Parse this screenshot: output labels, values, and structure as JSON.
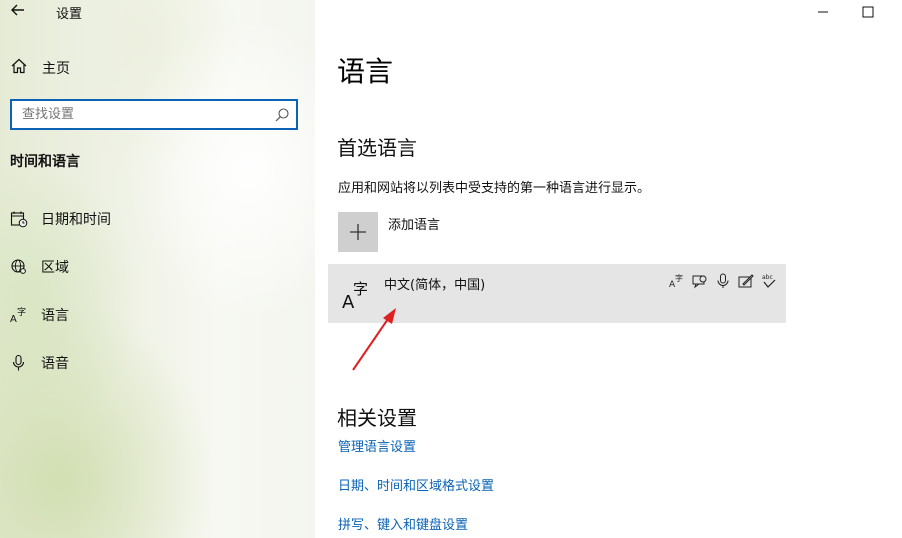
{
  "window": {
    "title": "设置",
    "minimize_glyph": "—",
    "maximize_glyph": "☐"
  },
  "sidebar": {
    "home_label": "主页",
    "search": {
      "placeholder": "查找设置",
      "value": ""
    },
    "section_title": "时间和语言",
    "items": [
      {
        "label": "日期和时间",
        "icon": "calendar-clock-icon"
      },
      {
        "label": "区域",
        "icon": "globe-region-icon"
      },
      {
        "label": "语言",
        "icon": "language-icon"
      },
      {
        "label": "语音",
        "icon": "microphone-icon"
      }
    ]
  },
  "main": {
    "title": "语言",
    "preferred": {
      "heading": "首选语言",
      "description": "应用和网站将以列表中受支持的第一种语言进行显示。",
      "add_label": "添加语言",
      "languages": [
        {
          "name": "中文(简体，中国)",
          "icon_text_a": "A",
          "icon_text_zi": "字",
          "features": [
            "display-language-icon",
            "text-to-speech-icon",
            "speech-recognition-icon",
            "handwriting-icon",
            "spell-check-icon"
          ]
        }
      ]
    },
    "related": {
      "heading": "相关设置",
      "links": [
        "管理语言设置",
        "日期、时间和区域格式设置",
        "拼写、键入和键盘设置"
      ]
    }
  },
  "colors": {
    "accent": "#0b63b5",
    "row_selected": "#e5e5e5",
    "annotation_arrow": "#e02020"
  }
}
